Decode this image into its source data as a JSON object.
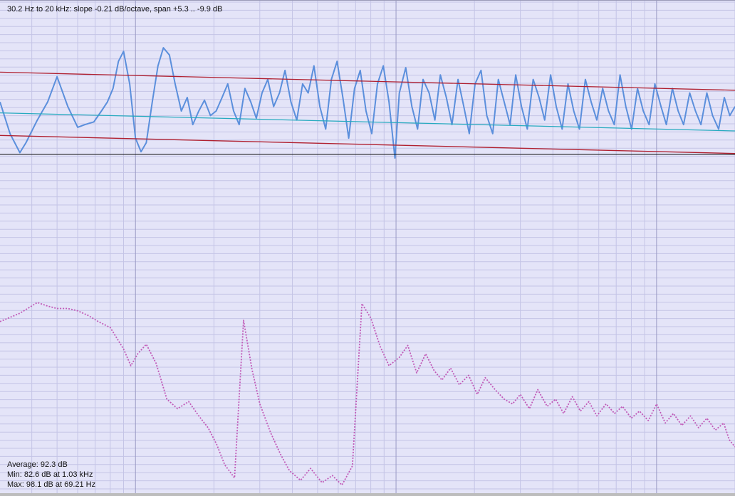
{
  "header": {
    "readout": "30.2 Hz to 20 kHz: slope -0.21 dB/octave, span +5.3 .. -9.9 dB"
  },
  "stats": {
    "average": "Average: 92.3 dB",
    "min": "Min: 82.6 dB at 1.03 kHz",
    "max": "Max: 98.1 dB at 69.21 Hz"
  },
  "colors": {
    "background": "#e4e4f8",
    "grid_minor": "#c4c4e6",
    "grid_major": "#9a9ac4",
    "response": "#5b8fdc",
    "regression": "#26aabf",
    "bounds": "#b02030",
    "reference": "#111111",
    "secondary": "#c05ab8"
  },
  "chart_data": {
    "type": "line",
    "title": "",
    "xlabel": "",
    "ylabel": "",
    "x_unit": "Hz",
    "x_scale": "log",
    "xlim": [
      30.2,
      20000
    ],
    "grid": true,
    "legend": "none",
    "series": [
      {
        "name": "",
        "style": "solid",
        "x": [
          30.2,
          33,
          36,
          38,
          42,
          46,
          50,
          55,
          60,
          64,
          69.21,
          74,
          78,
          82,
          86,
          90,
          95,
          100,
          105,
          110,
          116,
          122,
          128,
          135,
          142,
          150,
          158,
          166,
          175,
          184,
          194,
          204,
          215,
          226,
          238,
          250,
          263,
          277,
          291,
          306,
          322,
          339,
          357,
          375,
          395,
          416,
          438,
          460,
          484,
          510,
          537,
          565,
          594,
          625,
          658,
          693,
          729,
          767,
          807,
          849,
          894,
          940,
          990,
          1030,
          1090,
          1150,
          1210,
          1270,
          1340,
          1410,
          1480,
          1560,
          1640,
          1730,
          1820,
          1910,
          2010,
          2120,
          2230,
          2350,
          2470,
          2600,
          2740,
          2880,
          3030,
          3190,
          3360,
          3540,
          3720,
          3920,
          4120,
          4340,
          4570,
          4810,
          5060,
          5330,
          5610,
          5900,
          6210,
          6540,
          6880,
          7240,
          7620,
          8020,
          8450,
          8890,
          9360,
          9850,
          10400,
          10900,
          11500,
          12100,
          12700,
          13400,
          14100,
          14800,
          15600,
          16400,
          17300,
          18200,
          19100,
          20000
        ],
        "y": [
          2.0,
          -1.5,
          -3.6,
          -2.5,
          0.0,
          2.0,
          4.8,
          1.5,
          -0.8,
          -0.5,
          -0.2,
          1.0,
          2.0,
          3.5,
          6.5,
          7.6,
          4.0,
          -2.0,
          -3.5,
          -2.5,
          2.0,
          6.0,
          8.0,
          7.2,
          4.0,
          1.0,
          2.5,
          -0.5,
          1.0,
          2.2,
          0.5,
          1.0,
          2.5,
          4.0,
          1.0,
          -0.5,
          3.5,
          2.0,
          0.2,
          3.0,
          4.5,
          1.5,
          3.0,
          5.5,
          2.0,
          0.0,
          4.0,
          3.0,
          6.0,
          1.5,
          -1.0,
          4.5,
          6.5,
          2.5,
          -2.0,
          3.5,
          5.5,
          1.0,
          -1.5,
          4.0,
          6.0,
          2.0,
          -4.2,
          3.0,
          5.8,
          1.5,
          -1.0,
          4.5,
          3.0,
          0.0,
          5.0,
          2.5,
          -0.5,
          4.5,
          1.5,
          -1.5,
          4.0,
          5.5,
          0.5,
          -1.5,
          4.5,
          2.0,
          -0.5,
          5.0,
          1.5,
          -1.0,
          4.5,
          2.5,
          0.0,
          5.0,
          1.5,
          -1.0,
          4.0,
          1.0,
          -1.0,
          4.5,
          2.0,
          0.0,
          3.5,
          1.0,
          -0.5,
          5.0,
          1.5,
          -1.0,
          3.5,
          1.0,
          -0.5,
          4.0,
          1.5,
          -0.5,
          3.5,
          1.0,
          -0.5,
          3.0,
          1.0,
          -0.5,
          3.0,
          0.5,
          -1.0,
          2.5,
          0.5,
          1.5
        ]
      },
      {
        "name": "",
        "style": "solid",
        "x": [
          30.2,
          20000
        ],
        "y": [
          0.8,
          -1.2
        ]
      },
      {
        "name": "",
        "style": "solid",
        "x": [
          30.2,
          20000
        ],
        "y": [
          5.3,
          3.3
        ]
      },
      {
        "name": "",
        "style": "solid",
        "x": [
          30.2,
          20000
        ],
        "y": [
          -1.7,
          -3.7
        ]
      },
      {
        "name": "",
        "style": "solid",
        "x": [
          30.2,
          20000
        ],
        "y": [
          -3.8,
          -3.8
        ]
      },
      {
        "name": "",
        "style": "dotted",
        "x": [
          30.2,
          36,
          42,
          46,
          50,
          55,
          60,
          66,
          72,
          80,
          90,
          96,
          102,
          110,
          120,
          132,
          145,
          160,
          175,
          190,
          205,
          220,
          240,
          260,
          280,
          300,
          330,
          360,
          390,
          430,
          470,
          520,
          570,
          620,
          680,
          740,
          800,
          870,
          940,
          1030,
          1110,
          1200,
          1300,
          1400,
          1500,
          1620,
          1750,
          1900,
          2050,
          2200,
          2400,
          2600,
          2800,
          3000,
          3250,
          3500,
          3800,
          4100,
          4400,
          4750,
          5100,
          5500,
          5900,
          6400,
          6900,
          7400,
          8000,
          8600,
          9300,
          10000,
          10800,
          11600,
          12500,
          13500,
          14500,
          15600,
          16800,
          18100,
          19000,
          20000
        ],
        "y": [
          96.5,
          97.2,
          98.1,
          97.8,
          97.6,
          97.6,
          97.4,
          97.0,
          96.5,
          96.0,
          94.2,
          92.8,
          93.8,
          94.6,
          93.0,
          90.0,
          89.2,
          89.8,
          88.6,
          87.6,
          86.2,
          84.5,
          83.4,
          96.6,
          92.5,
          89.6,
          87.2,
          85.4,
          84.0,
          83.2,
          84.2,
          83.0,
          83.6,
          82.8,
          84.4,
          98.0,
          96.8,
          94.4,
          92.8,
          93.5,
          94.5,
          92.2,
          93.8,
          92.4,
          91.6,
          92.6,
          91.2,
          92.0,
          90.4,
          91.8,
          90.8,
          90.0,
          89.6,
          90.4,
          89.2,
          90.8,
          89.4,
          90.0,
          88.8,
          90.2,
          89.0,
          89.8,
          88.6,
          89.6,
          88.8,
          89.4,
          88.4,
          89.0,
          88.2,
          89.6,
          88.0,
          88.8,
          87.8,
          88.6,
          87.6,
          88.4,
          87.4,
          88.0,
          86.6,
          86.0
        ]
      }
    ]
  }
}
